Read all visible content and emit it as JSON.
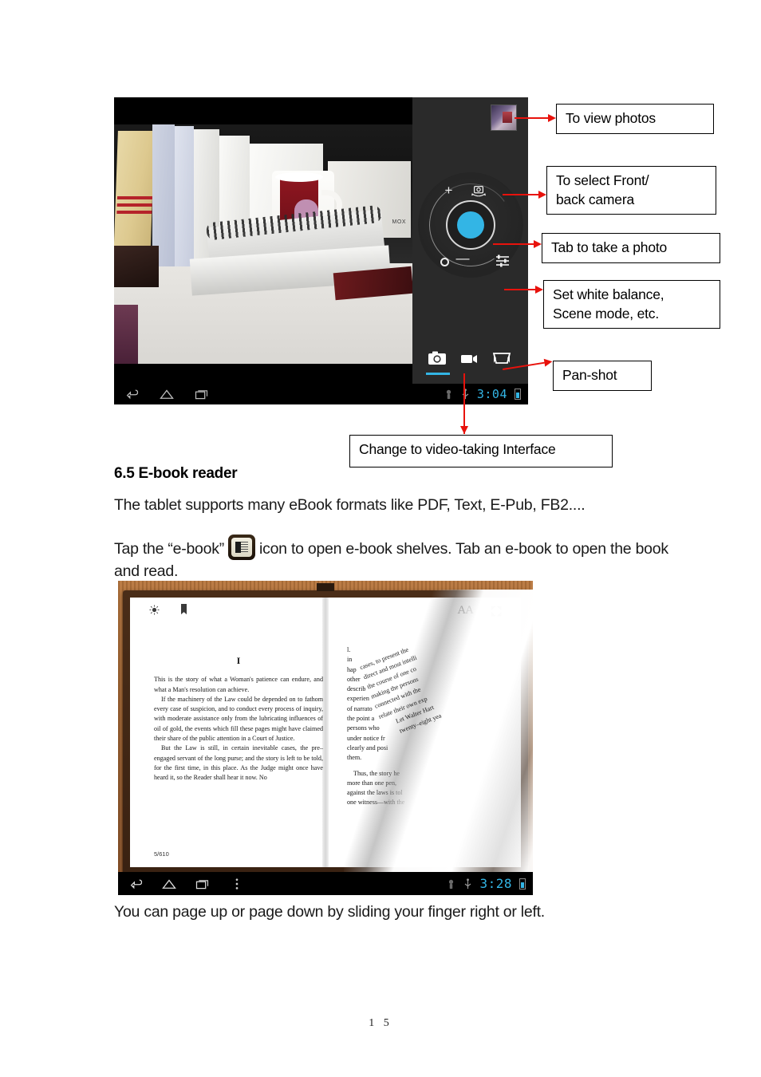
{
  "document": {
    "section_heading": "6.5 E-book reader",
    "paragraph_1": "The tablet supports many eBook formats like PDF, Text, E-Pub, FB2....",
    "paragraph_2_before_icon": "Tap the “e-book”",
    "paragraph_2_after_icon": "icon to open e-book shelves. Tab an e-book to open the book and read.",
    "paragraph_3": "You can page up or page down by sliding your finger right or left.",
    "page_number": "1 5",
    "ebook_icon_name": "e-book-icon"
  },
  "callouts": [
    {
      "id": "view-photos",
      "text": "To view photos"
    },
    {
      "id": "front-back",
      "text": "To select Front/ back camera"
    },
    {
      "id": "take-photo",
      "text": "Tab to take a photo"
    },
    {
      "id": "white-balance",
      "text": "Set white balance, Scene mode, etc."
    },
    {
      "id": "pan-shot",
      "text": "Pan-shot"
    },
    {
      "id": "video-mode",
      "text": "Change to video-taking Interface"
    }
  ],
  "callout_lines": {
    "front_back_line1": "To select Front/",
    "front_back_line2": "back camera",
    "white_balance_line1": "Set white balance,",
    "white_balance_line2": "Scene mode, etc."
  },
  "camera_screenshot": {
    "clock": "3:04",
    "modes": [
      {
        "name": "photo-mode",
        "icon": "camera-icon",
        "active": true
      },
      {
        "name": "video-mode",
        "icon": "video-camera-icon",
        "active": false
      },
      {
        "name": "panorama-mode",
        "icon": "panorama-icon",
        "active": false
      }
    ],
    "controls": {
      "shutter": "shutter-button",
      "zoom_in": "+",
      "zoom_out": "—",
      "flip_camera": "switch-camera-icon",
      "settings": "settings-sliders-icon"
    },
    "nav_icons": [
      "back-icon",
      "home-icon",
      "recents-icon"
    ],
    "status_icons": [
      "screenshot-icon",
      "usb-icon",
      "battery-icon"
    ],
    "accent_color": "#33b5e5",
    "mug_label": "MOX"
  },
  "ebook_screenshot": {
    "toolbar_left": [
      "brightness-icon",
      "bookmark-icon"
    ],
    "toolbar_right": [
      "font-size-aa-icon",
      "fullscreen-icon"
    ],
    "font_size_label": "AA",
    "page_indicator": "5/610",
    "chapter": "I",
    "left_page_paragraphs": [
      "This is the story of what a Woman's patience can endure, and what a Man's resolution can achieve.",
      "If the machinery of the Law could be depended on to fathom every case of suspicion, and to conduct every process of inquiry, with moderate assistance only from the lubricating influences of oil of gold, the events which fill these pages might have claimed their share of the public attention in a Court of Justice.",
      "But the Law is still, in certain inevitable cases, the pre–engaged servant of the long purse; and the story is left to be told, for the first time, in this place. As the Judge might once have heard it, so the Reader shall hear it now. No"
    ],
    "right_page_fragments": [
      "l.",
      "in",
      "hap",
      "other",
      "describ",
      "experien",
      "of narrato",
      "the point a",
      "persons who",
      "under notice fr",
      "clearly and posi",
      "them."
    ],
    "right_page_tail": [
      "Thus, the story he",
      "more than one pen,",
      "against the laws is tol",
      "one witness—with the"
    ],
    "turning_page_lines": [
      "cases, to present the",
      "direct and most intelli",
      "the course of one co",
      "making the persons",
      "connected with the",
      "relate their own exp",
      "Let Walter Hart",
      "twenty–eight yea"
    ],
    "clock": "3:28",
    "nav_icons": [
      "back-icon",
      "home-icon",
      "recents-icon",
      "menu-icon"
    ],
    "status_icons": [
      "screenshot-icon",
      "usb-icon",
      "battery-icon"
    ],
    "accent_color": "#33b5e5"
  }
}
